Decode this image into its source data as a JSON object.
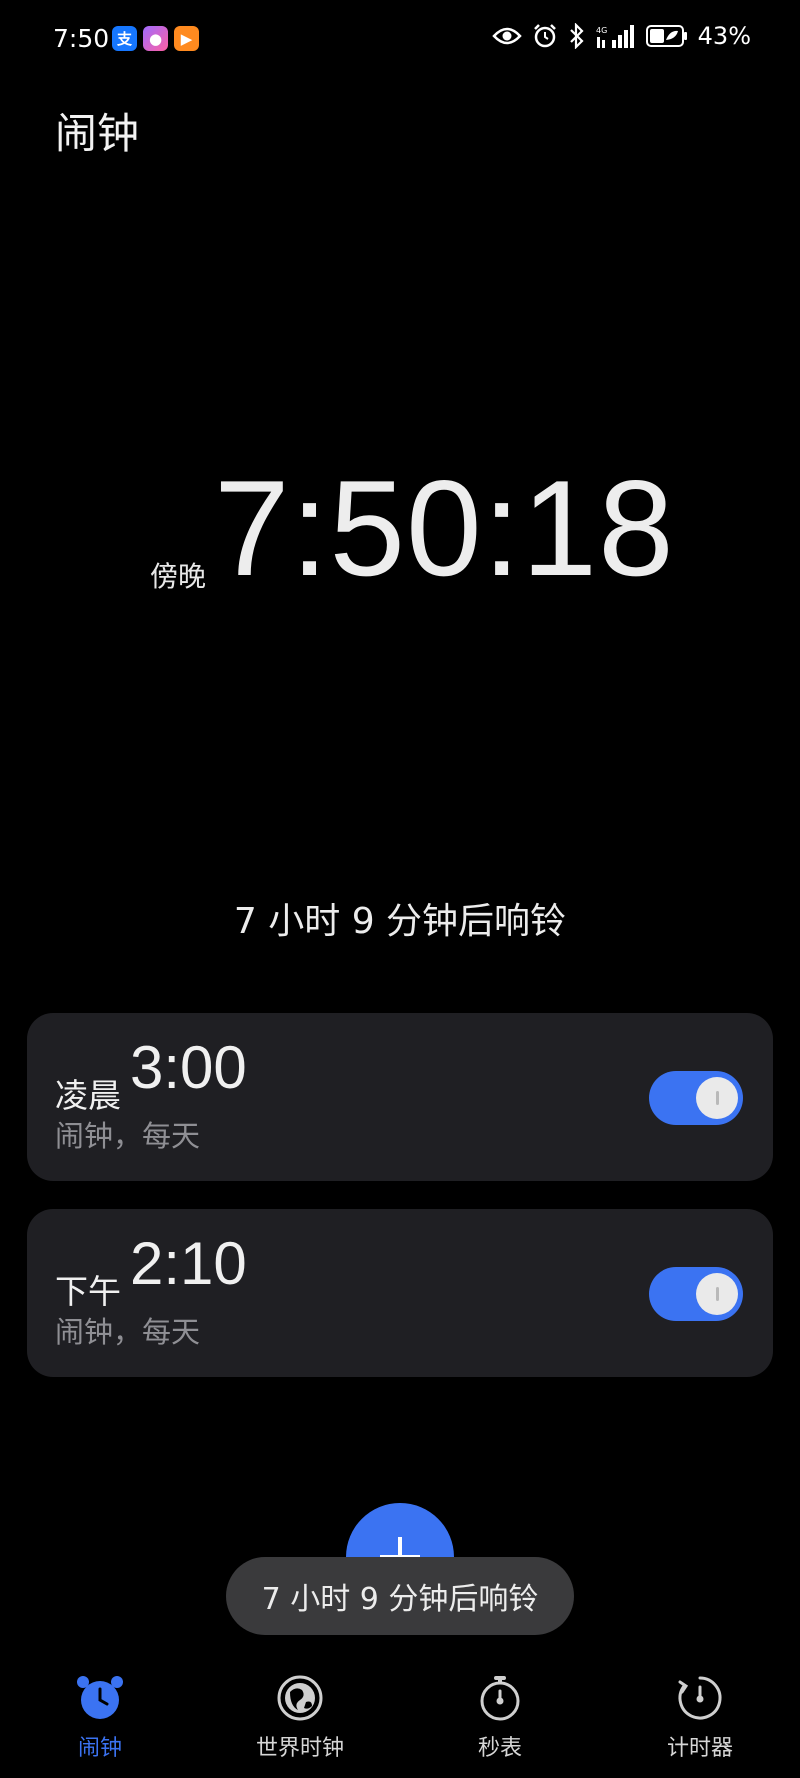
{
  "status_bar": {
    "time": "7:50",
    "app_icons": [
      "alipay-icon",
      "app-icon",
      "video-app-icon"
    ],
    "app_glyphs": [
      "支",
      "●",
      "▶"
    ],
    "battery_percent": "43%",
    "indicators": [
      "eye-icon",
      "alarm-icon",
      "bluetooth-icon",
      "signal-icon",
      "battery-icon"
    ]
  },
  "page": {
    "title": "闹钟"
  },
  "clock": {
    "period": "傍晚",
    "time": "7:50:18"
  },
  "next_ring": "7 小时 9 分钟后响铃",
  "alarms": [
    {
      "period": "凌晨",
      "time": "3:00",
      "subtitle": "闹钟，每天",
      "enabled": true
    },
    {
      "period": "下午",
      "time": "2:10",
      "subtitle": "闹钟，每天",
      "enabled": true
    }
  ],
  "toast": "7 小时 9 分钟后响铃",
  "bottom_nav": {
    "items": [
      {
        "label": "闹钟",
        "icon": "alarm-clock-icon",
        "active": true
      },
      {
        "label": "世界时钟",
        "icon": "globe-icon",
        "active": false
      },
      {
        "label": "秒表",
        "icon": "stopwatch-icon",
        "active": false
      },
      {
        "label": "计时器",
        "icon": "timer-icon",
        "active": false
      }
    ]
  },
  "colors": {
    "accent": "#3b73f2",
    "card_bg": "#1f1f23",
    "background": "#000000",
    "toast_bg": "#3a3a3c"
  }
}
